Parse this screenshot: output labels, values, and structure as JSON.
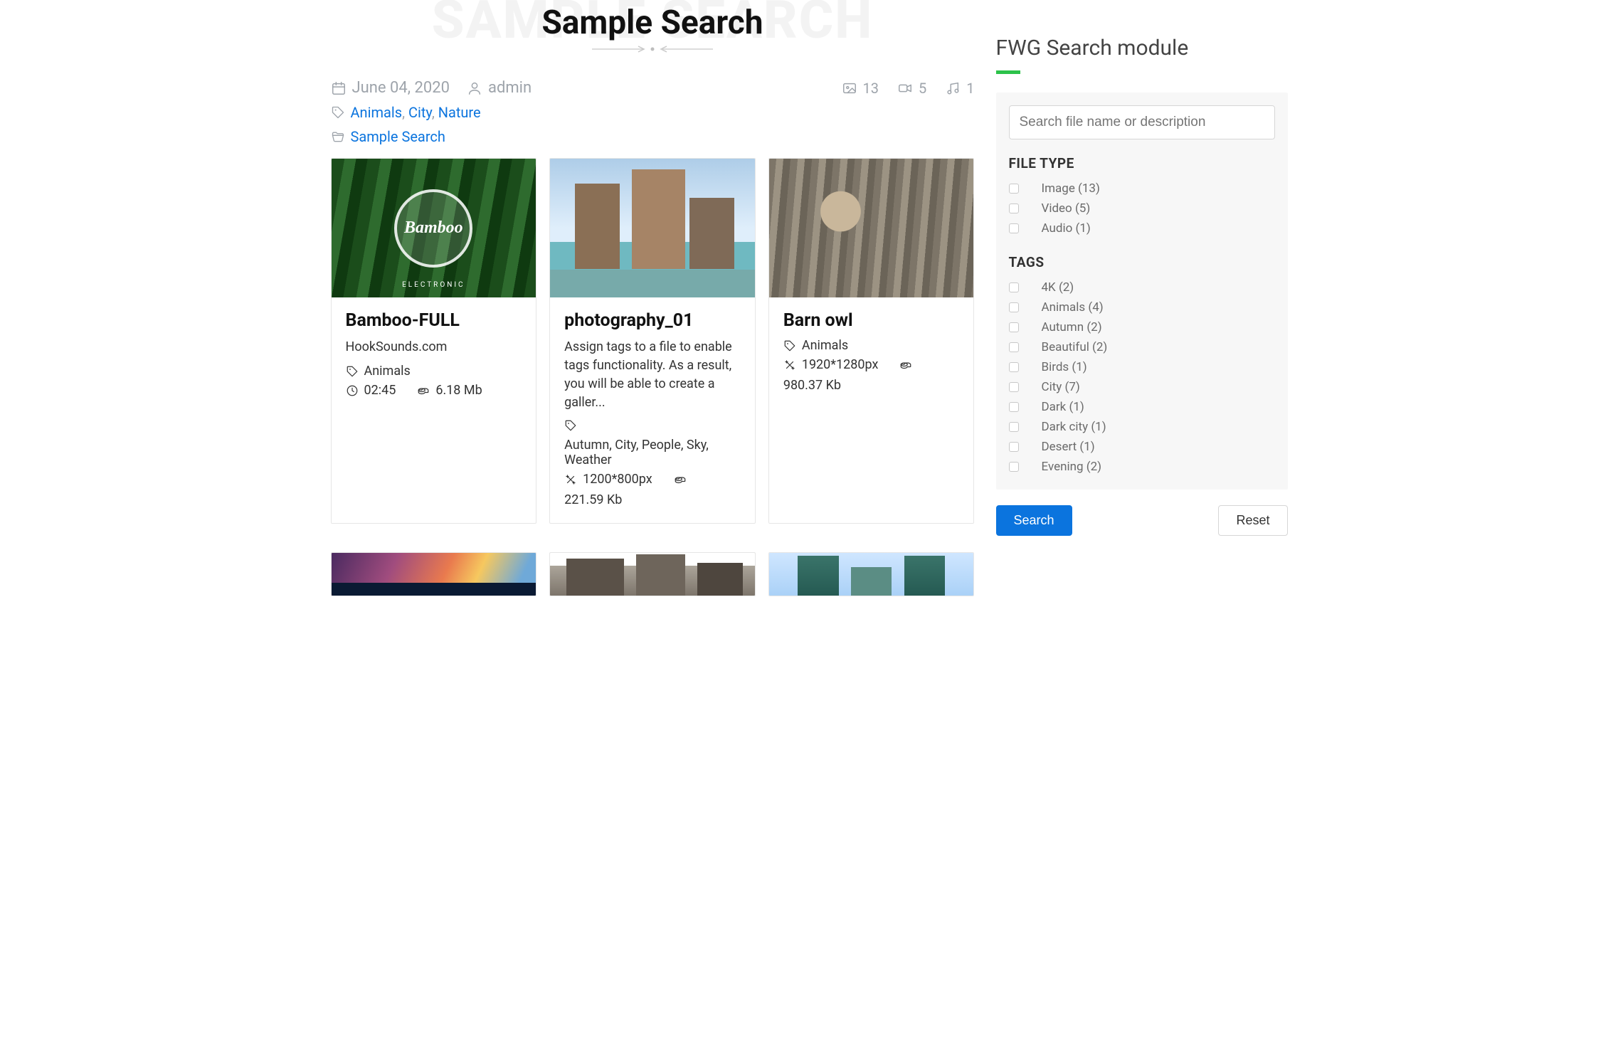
{
  "header": {
    "title": "Sample Search",
    "ghost": "SAMPLE SEARCH"
  },
  "meta": {
    "date": "June 04, 2020",
    "author": "admin",
    "counts": {
      "images": "13",
      "videos": "5",
      "audio": "1"
    },
    "tags": [
      "Animals",
      "City",
      "Nature"
    ],
    "categories": [
      "Sample Search"
    ]
  },
  "cards": [
    {
      "title": "Bamboo-FULL",
      "thumb_word": "Bamboo",
      "thumb_genre": "ELECTRONIC",
      "desc": "HookSounds.com",
      "tags": "Animals",
      "duration": "02:45",
      "size": "6.18 Mb"
    },
    {
      "title": "photography_01",
      "desc": "Assign tags to a file to enable tags functionality. As a result, you will be able to create a galler...",
      "tags": "Autumn, City, People, Sky, Weather",
      "dims": "1200*800px",
      "size": "221.59 Kb"
    },
    {
      "title": "Barn owl",
      "tags": "Animals",
      "dims": "1920*1280px",
      "size": "980.37 Kb"
    }
  ],
  "sidebar": {
    "heading": "FWG Search module",
    "search_placeholder": "Search file name or description",
    "file_type": {
      "title": "FILE TYPE",
      "options": [
        "Image (13)",
        "Video (5)",
        "Audio (1)"
      ]
    },
    "tags": {
      "title": "TAGS",
      "options": [
        "4K (2)",
        "Animals (4)",
        "Autumn (2)",
        "Beautiful (2)",
        "Birds (1)",
        "City (7)",
        "Dark (1)",
        "Dark city (1)",
        "Desert (1)",
        "Evening (2)"
      ]
    },
    "search_btn": "Search",
    "reset_btn": "Reset"
  }
}
